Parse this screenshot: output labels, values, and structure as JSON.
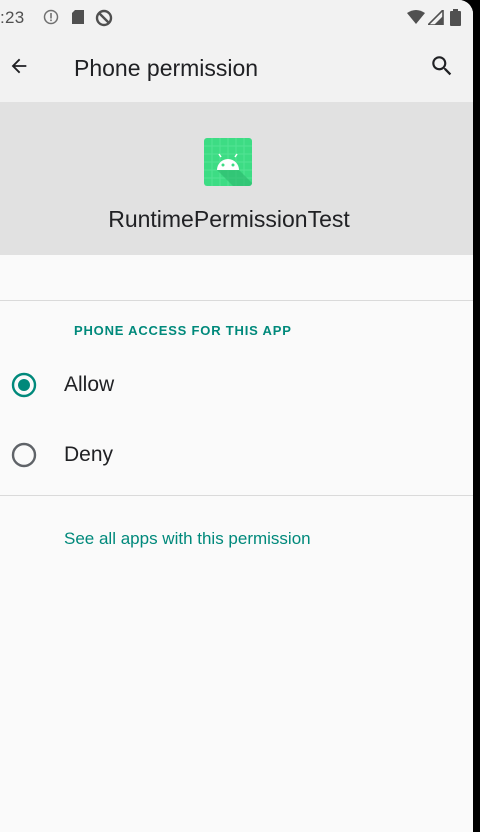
{
  "status_bar": {
    "time": ":23"
  },
  "app_bar": {
    "title": "Phone permission",
    "back_icon": "arrow-back-icon",
    "search_icon": "search-icon"
  },
  "app": {
    "name": "RuntimePermissionTest",
    "icon": "android-app-icon"
  },
  "permission": {
    "section_header": "PHONE ACCESS FOR THIS APP",
    "options": [
      {
        "label": "Allow",
        "selected": true
      },
      {
        "label": "Deny",
        "selected": false
      }
    ]
  },
  "links": {
    "see_all": "See all apps with this permission"
  },
  "colors": {
    "accent": "#00897b",
    "radio_unselected": "#5f6368"
  }
}
